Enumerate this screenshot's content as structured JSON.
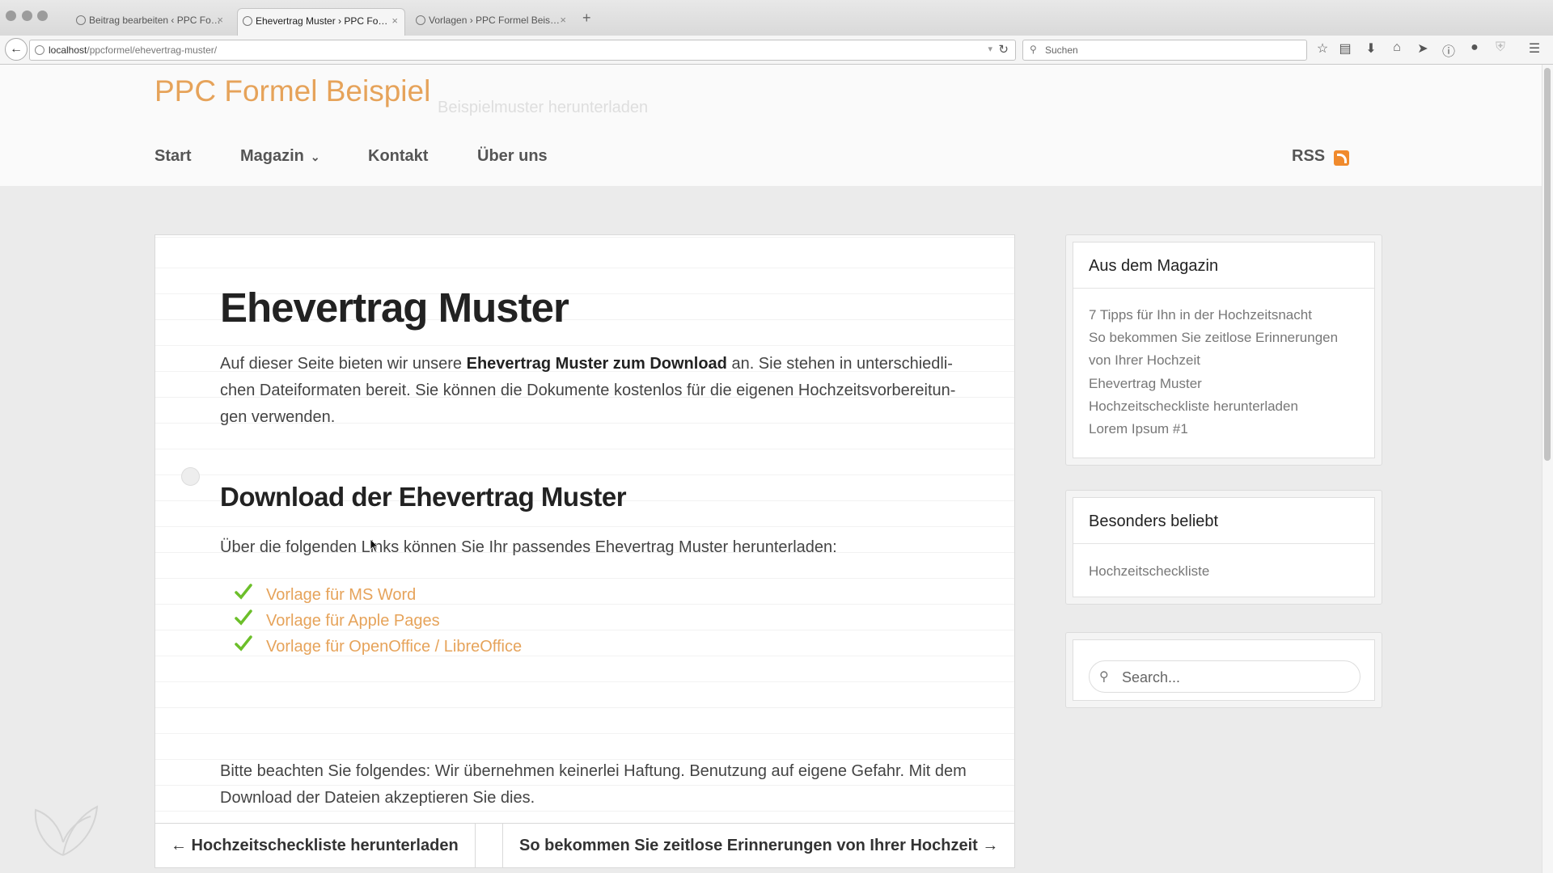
{
  "browser": {
    "tabs": [
      {
        "title": "Beitrag bearbeiten ‹ PPC Fo…"
      },
      {
        "title": "Ehevertrag Muster › PPC Fo…"
      },
      {
        "title": "Vorlagen › PPC Formel Beis…"
      }
    ],
    "tab_close": "×",
    "new_tab": "+",
    "url_host": "localhost",
    "url_path": "/ppcformel/ehevertrag-muster/",
    "search_placeholder": "Suchen"
  },
  "site": {
    "title": "PPC Formel Beispiel",
    "tagline": "Beispielmuster herunterladen",
    "nav": {
      "start": "Start",
      "magazin": "Magazin",
      "kontakt": "Kontakt",
      "ueber_uns": "Über uns",
      "rss": "RSS"
    }
  },
  "article": {
    "title": "Ehevertrag Muster",
    "intro_1": "Auf dieser Seite bieten wir unsere ",
    "intro_bold": "Ehevertrag Muster zum Download",
    "intro_2": " an. Sie stehen in unterschiedli-chen Dateiformaten bereit. Sie können die Dokumente kostenlos für die eigenen Hochzeitsvorbereitun-gen verwenden.",
    "download_heading": "Download der Ehevertrag Muster",
    "download_text": "Über die folgenden Links können Sie Ihr passendes Ehevertrag Muster herunterladen:",
    "downloads": [
      "Vorlage für MS Word",
      "Vorlage für Apple Pages",
      "Vorlage für OpenOffice / LibreOffice"
    ],
    "disclaimer": "Bitte beachten Sie folgendes: Wir übernehmen keinerlei Haftung. Benutzung auf eigene Gefahr. Mit dem Download der Dateien akzeptieren Sie dies."
  },
  "sidebar": {
    "magazin": {
      "title": "Aus dem Magazin",
      "links": [
        "7 Tipps für Ihn in der Hochzeitsnacht",
        "So bekommen Sie zeitlose Erinnerungen",
        "von Ihrer Hochzeit",
        "Ehevertrag Muster",
        "Hochzeitscheckliste herunterladen",
        "Lorem Ipsum #1"
      ]
    },
    "beliebt": {
      "title": "Besonders beliebt",
      "links": [
        "Hochzeitscheckliste"
      ]
    },
    "search": {
      "placeholder": "Search..."
    }
  },
  "pager": {
    "prev": "← Hochzeitscheckliste herunterladen",
    "next": "So bekommen Sie zeitlose Erinnerungen von Ihrer Hochzeit →"
  },
  "colors": {
    "accent": "#e6a35a",
    "check": "#6cbf2a",
    "rss": "#f08a2c"
  }
}
